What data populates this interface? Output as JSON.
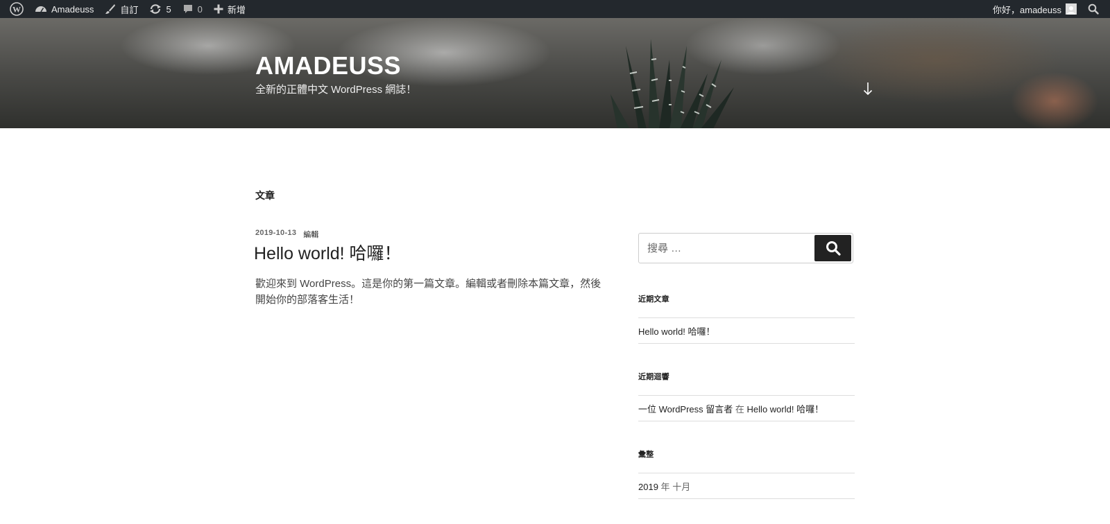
{
  "adminbar": {
    "site_name": "Amadeuss",
    "customize": "自訂",
    "updates_count": "5",
    "comments_count": "0",
    "new_label": "新增",
    "greeting": "你好，amadeuss"
  },
  "header": {
    "title": "AMADEUSS",
    "description": "全新的正體中文 WordPress 網誌！"
  },
  "main": {
    "heading": "文章",
    "post": {
      "date": "2019-10-13",
      "edit_label": "編輯",
      "title": "Hello world! 哈囉！",
      "content": "歡迎來到 WordPress。這是你的第一篇文章。編輯或者刪除本篇文章，然後開始你的部落客生活！"
    }
  },
  "sidebar": {
    "search_placeholder": "搜尋 …",
    "recent_posts_title": "近期文章",
    "recent_posts": [
      "Hello world! 哈囉！"
    ],
    "recent_comments_title": "近期迴響",
    "recent_comment": {
      "author": "一位 WordPress 留言者",
      "connector": "在",
      "post": "Hello world! 哈囉！"
    },
    "archives_title": "彙整",
    "archive": {
      "year": "2019",
      "year_suffix": "年",
      "month": "十月"
    }
  }
}
